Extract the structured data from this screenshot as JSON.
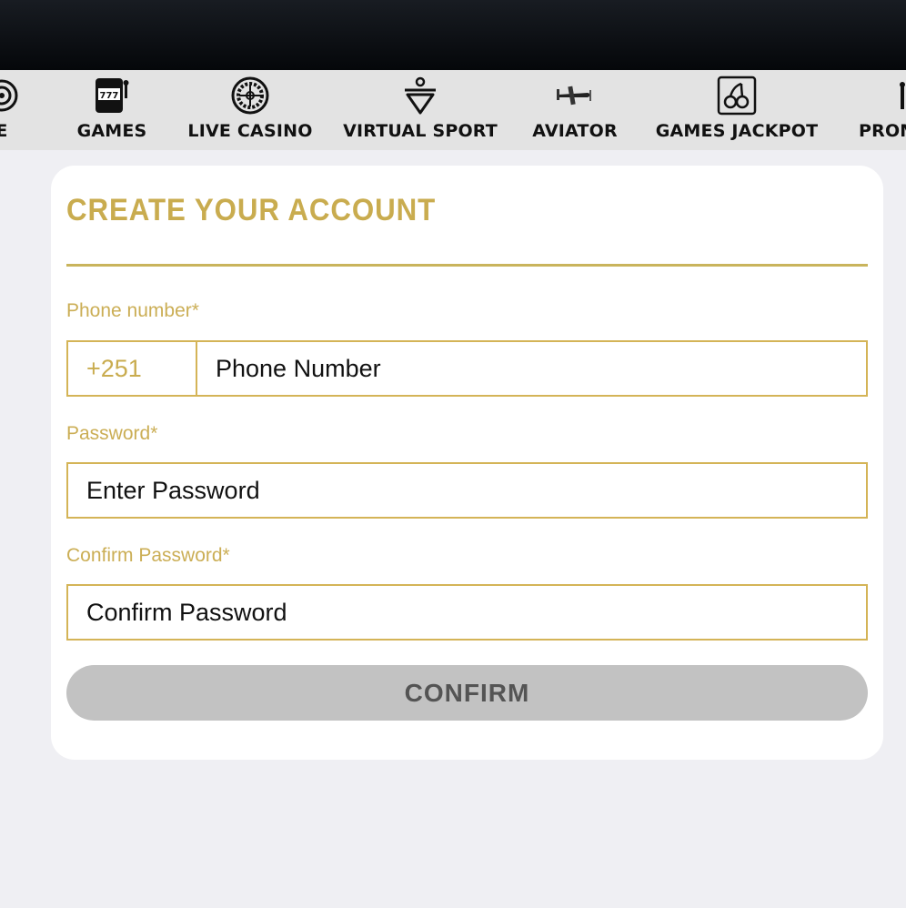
{
  "nav": {
    "items": [
      {
        "label": "E",
        "icon": "target-icon"
      },
      {
        "label": "GAMES",
        "icon": "slot-machine-icon"
      },
      {
        "label": "LIVE CASINO",
        "icon": "roulette-icon"
      },
      {
        "label": "VIRTUAL SPORT",
        "icon": "virtual-sport-icon"
      },
      {
        "label": "AVIATOR",
        "icon": "airplane-icon"
      },
      {
        "label": "GAMES JACKPOT",
        "icon": "cherries-icon"
      },
      {
        "label": "PROM",
        "icon": "promo-icon"
      }
    ]
  },
  "form": {
    "title": "CREATE YOUR ACCOUNT",
    "phone_label": "Phone number*",
    "phone_prefix": "+251",
    "phone_placeholder": "Phone Number",
    "password_label": "Password*",
    "password_placeholder": "Enter Password",
    "confirm_label": "Confirm Password*",
    "confirm_placeholder": "Confirm Password",
    "confirm_button": "CONFIRM"
  },
  "colors": {
    "accent": "#c9ac4f",
    "header_bg": "#0b0e12",
    "nav_bg": "#e3e3e3",
    "page_bg": "#efeff3",
    "button_disabled": "#c2c2c2"
  }
}
